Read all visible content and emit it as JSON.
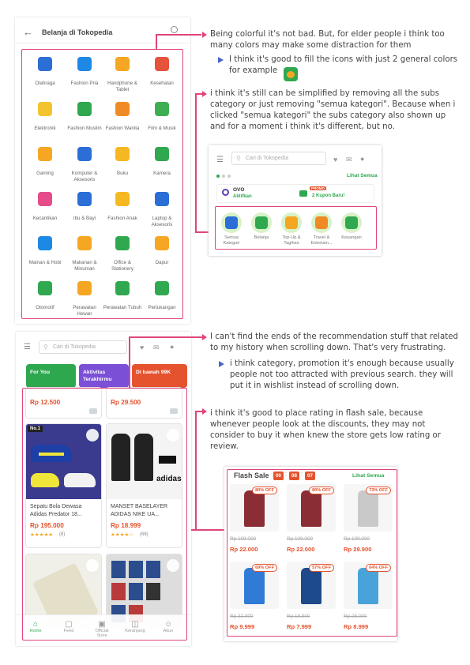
{
  "panel1": {
    "title": "Belanja di Tokopedia",
    "categories": [
      {
        "label": "Olahraga",
        "icon": "sport-icon",
        "color": "#2b6fd6"
      },
      {
        "label": "Fashion Pria",
        "icon": "shirt-icon",
        "color": "#1e88e5"
      },
      {
        "label": "Handphone & Tablet",
        "icon": "phone-icon",
        "color": "#f5a623"
      },
      {
        "label": "Kesehatan",
        "icon": "health-icon",
        "color": "#e5533b"
      },
      {
        "label": "Elektronik",
        "icon": "lamp-icon",
        "color": "#f4c430"
      },
      {
        "label": "Fashion Muslim",
        "icon": "muslim-icon",
        "color": "#2fa84f"
      },
      {
        "label": "Fashion Wanita",
        "icon": "dress-icon",
        "color": "#f08a24"
      },
      {
        "label": "Film & Musik",
        "icon": "music-icon",
        "color": "#3fae52"
      },
      {
        "label": "Gaming",
        "icon": "gamepad-icon",
        "color": "#f5a623"
      },
      {
        "label": "Komputer & Aksesoris",
        "icon": "monitor-icon",
        "color": "#2b6fd6"
      },
      {
        "label": "Buku",
        "icon": "book-icon",
        "color": "#f5b820"
      },
      {
        "label": "Kamera",
        "icon": "camera-icon",
        "color": "#2fa84f"
      },
      {
        "label": "Kecantikan",
        "icon": "lipstick-icon",
        "color": "#e74c8a"
      },
      {
        "label": "Ibu & Bayi",
        "icon": "baby-icon",
        "color": "#2b6fd6"
      },
      {
        "label": "Fashion Anak",
        "icon": "kidswear-icon",
        "color": "#f5b820"
      },
      {
        "label": "Laptop & Aksesoris",
        "icon": "laptop-icon",
        "color": "#2b6fd6"
      },
      {
        "label": "Mainan & Hobi",
        "icon": "toy-icon",
        "color": "#1e88e5"
      },
      {
        "label": "Makanan & Minuman",
        "icon": "food-icon",
        "color": "#f5a623"
      },
      {
        "label": "Office & Stationery",
        "icon": "stationery-icon",
        "color": "#2fa84f"
      },
      {
        "label": "Dapur",
        "icon": "kitchen-icon",
        "color": "#f5a623"
      },
      {
        "label": "Otomotif",
        "icon": "wheel-icon",
        "color": "#2fa84f"
      },
      {
        "label": "Perawatan Hewan",
        "icon": "bone-icon",
        "color": "#f5a623"
      },
      {
        "label": "Perawatan Tubuh",
        "icon": "bodycare-icon",
        "color": "#2fa84f"
      },
      {
        "label": "Pertukangan",
        "icon": "hammer-icon",
        "color": "#2fa84f"
      }
    ]
  },
  "notes": {
    "n1": "Being colorful it's not bad. But, for elder people i think too many colors may make some distraction for them",
    "n1_bullet": "I think it's good to fill the icons with just 2 general colors for example",
    "n2": "i think it's still can be simplified by removing all the subs category or just removing \"semua kategori\". Because when i clicked \"semua kategori\" the subs category also shown up and for a moment i think it's different, but no.",
    "n3": "I can't find the ends of the recommendation stuff that related to my history when scrolling down. That's very frustrating.",
    "n3_bullet": "i think category, promotion it's enough because usually people not too attracted with previous search. they will put it in wishlist instead of scrolling down.",
    "n4": "i think it's good to place rating in flash sale, because whenever people look at the discounts, they may not consider to buy it when knew the store gets low rating or review."
  },
  "mini": {
    "search_placeholder": "Cari di Tokopedia",
    "lihat_semua": "Lihat Semua",
    "ovo": "OVO",
    "ovo_sub": "Aktifkan",
    "promo_badge": "PROMO",
    "kupon": "2 Kupon Baru!",
    "items": [
      "Semua Kategori",
      "Belanja",
      "Top-Up & Tagihan",
      "Travel & Entertain...",
      "Keuangan"
    ]
  },
  "panel3": {
    "search_placeholder": "Cari di Tokopedia",
    "tabs": [
      {
        "label": "For You",
        "color": "#2ea84f"
      },
      {
        "label": "Aktivitas Terakhirmu",
        "color": "#7b4fd6"
      },
      {
        "label": "Di bawah 99K",
        "color": "#e4532e"
      }
    ],
    "top_prices": [
      "Rp 12.500",
      "Rp 29.500"
    ],
    "products": [
      {
        "name": "Sepatu Bola Dewasa Adidas Predator 18...",
        "price": "Rp 195.000",
        "stars": "★★★★★",
        "count": "(8)"
      },
      {
        "name": "MANSET BASELAYER ADIDAS NIKE UA...",
        "price": "Rp 18.999",
        "stars": "★★★★☆",
        "count": "(66)"
      }
    ],
    "nav": [
      "Home",
      "Feed",
      "Official Store",
      "Keranjang",
      "Akun"
    ]
  },
  "flash": {
    "title": "Flash Sale",
    "timer": [
      "00",
      "08",
      "07"
    ],
    "lihat_semua": "Lihat Semua",
    "items": [
      {
        "off": "80% OFF",
        "old": "Rp 109.000",
        "price": "Rp 22.000"
      },
      {
        "off": "80% OFF",
        "old": "Rp 109.000",
        "price": "Rp 22.000"
      },
      {
        "off": "73% OFF",
        "old": "Rp 109.000",
        "price": "Rp 29.900"
      },
      {
        "off": "69% OFF",
        "old": "Rp 32.000",
        "price": "Rp 9.999"
      },
      {
        "off": "57% OFF",
        "old": "Rp 18.500",
        "price": "Rp 7.999"
      },
      {
        "off": "64% OFF",
        "old": "Rp 25.000",
        "price": "Rp 8.999"
      }
    ]
  },
  "colors": {
    "accent": "#e0457b",
    "brand_green": "#2ea84f",
    "price": "#e4532e",
    "bullet": "#4a66c9"
  }
}
